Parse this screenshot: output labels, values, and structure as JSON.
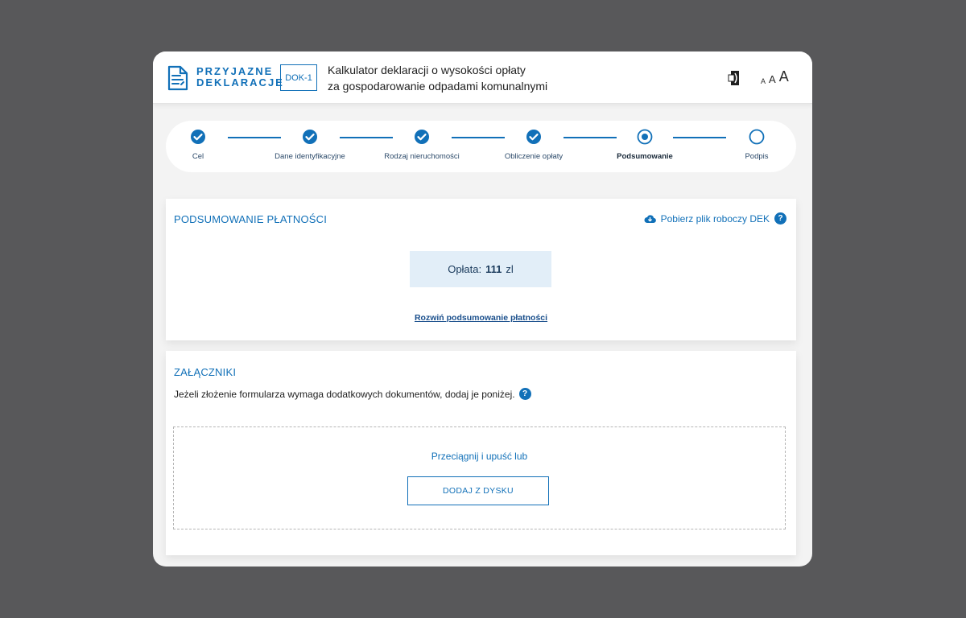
{
  "header": {
    "logo_line1": "PRZYJAZNE",
    "logo_line2": "DEKLARACJE",
    "badge": "DOK-1",
    "title_line1": "Kalkulator deklaracji o wysokości opłaty",
    "title_line2": "za gospodarowanie odpadami komunalnymi",
    "font_small": "A",
    "font_medium": "A",
    "font_large": "A"
  },
  "stepper": {
    "steps": [
      {
        "label": "Cel",
        "state": "done"
      },
      {
        "label": "Dane identyfikacyjne",
        "state": "done"
      },
      {
        "label": "Rodzaj nieruchomości",
        "state": "done"
      },
      {
        "label": "Obliczenie opłaty",
        "state": "done"
      },
      {
        "label": "Podsumowanie",
        "state": "current"
      },
      {
        "label": "Podpis",
        "state": "pending"
      }
    ]
  },
  "payment": {
    "title": "PODSUMOWANIE PŁATNOŚCI",
    "download_label": "Pobierz plik roboczy DEK",
    "help": "?",
    "fee_label": "Opłata:",
    "fee_amount": "111",
    "fee_currency": "zl",
    "expand_label": "Rozwiń podsumowanie płatności"
  },
  "attachments": {
    "title": "ZAŁĄCZNIKI",
    "description": "Jeżeli złożenie formularza wymaga dodatkowych dokumentów, dodaj je poniżej.",
    "help": "?",
    "drop_text": "Przeciągnij i upuść lub",
    "button_label": "DODAJ Z DYSKU"
  },
  "colors": {
    "accent": "#1170b8",
    "background": "#58585a",
    "fee_box": "#e2eef8"
  },
  "icons": [
    "document-icon",
    "contrast-icon",
    "check-icon",
    "cloud-download-icon",
    "help-icon"
  ]
}
